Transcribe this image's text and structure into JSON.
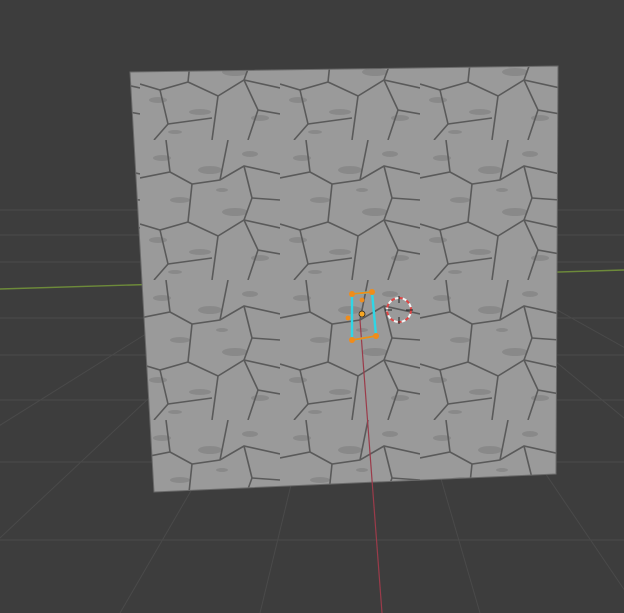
{
  "viewport": {
    "background": "#3d3d3d",
    "grid_color": "#4a4a4a",
    "x_axis_color": "#6d8a3a",
    "y_axis_color": "#9b3b4a"
  },
  "mesh": {
    "face_color": "#9a9a9a",
    "edge_color": "#5f5f5f",
    "selection": {
      "vertex_color": "#f08c1a",
      "edge_color": "#2fd6e6",
      "origin_color": "#f5a623"
    }
  },
  "cursor": {
    "icon": "3d-cursor-icon",
    "ring_color_a": "#e04545",
    "ring_color_b": "#f2f2f2"
  }
}
